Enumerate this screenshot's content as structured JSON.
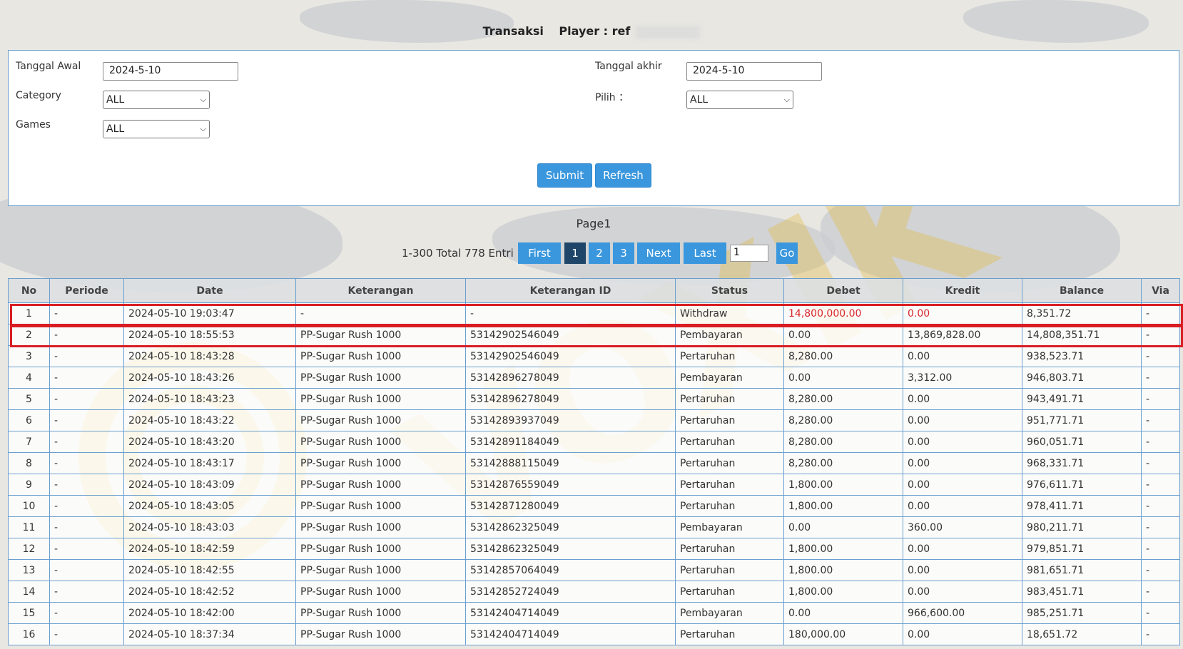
{
  "header": {
    "title": "Transaksi",
    "player_label": "Player : ref"
  },
  "filters": {
    "tanggal_awal_label": "Tanggal Awal",
    "tanggal_awal_value": "2024-5-10",
    "tanggal_akhir_label": "Tanggal akhir",
    "tanggal_akhir_value": "2024-5-10",
    "category_label": "Category",
    "category_value": "ALL",
    "pilih_label": "Pilih ：",
    "pilih_value": "ALL",
    "games_label": "Games",
    "games_value": "ALL",
    "submit_label": "Submit",
    "refresh_label": "Refresh"
  },
  "pagination": {
    "page_title": "Page1",
    "info": "1-300 Total 778 Entri",
    "first": "First",
    "pages": [
      "1",
      "2",
      "3"
    ],
    "next": "Next",
    "last": "Last",
    "goto_value": "1",
    "go": "Go"
  },
  "table": {
    "columns": [
      "No",
      "Periode",
      "Date",
      "Keterangan",
      "Keterangan ID",
      "Status",
      "Debet",
      "Kredit",
      "Balance",
      "Via"
    ],
    "rows": [
      [
        "1",
        "-",
        "2024-05-10 19:03:47",
        "-",
        "-",
        "Withdraw",
        "14,800,000.00",
        "0.00",
        "8,351.72",
        "-"
      ],
      [
        "2",
        "-",
        "2024-05-10 18:55:53",
        "PP-Sugar Rush 1000",
        "53142902546049",
        "Pembayaran",
        "0.00",
        "13,869,828.00",
        "14,808,351.71",
        "-"
      ],
      [
        "3",
        "-",
        "2024-05-10 18:43:28",
        "PP-Sugar Rush 1000",
        "53142902546049",
        "Pertaruhan",
        "8,280.00",
        "0.00",
        "938,523.71",
        "-"
      ],
      [
        "4",
        "-",
        "2024-05-10 18:43:26",
        "PP-Sugar Rush 1000",
        "53142896278049",
        "Pembayaran",
        "0.00",
        "3,312.00",
        "946,803.71",
        "-"
      ],
      [
        "5",
        "-",
        "2024-05-10 18:43:23",
        "PP-Sugar Rush 1000",
        "53142896278049",
        "Pertaruhan",
        "8,280.00",
        "0.00",
        "943,491.71",
        "-"
      ],
      [
        "6",
        "-",
        "2024-05-10 18:43:22",
        "PP-Sugar Rush 1000",
        "53142893937049",
        "Pertaruhan",
        "8,280.00",
        "0.00",
        "951,771.71",
        "-"
      ],
      [
        "7",
        "-",
        "2024-05-10 18:43:20",
        "PP-Sugar Rush 1000",
        "53142891184049",
        "Pertaruhan",
        "8,280.00",
        "0.00",
        "960,051.71",
        "-"
      ],
      [
        "8",
        "-",
        "2024-05-10 18:43:17",
        "PP-Sugar Rush 1000",
        "53142888115049",
        "Pertaruhan",
        "8,280.00",
        "0.00",
        "968,331.71",
        "-"
      ],
      [
        "9",
        "-",
        "2024-05-10 18:43:09",
        "PP-Sugar Rush 1000",
        "53142876559049",
        "Pertaruhan",
        "1,800.00",
        "0.00",
        "976,611.71",
        "-"
      ],
      [
        "10",
        "-",
        "2024-05-10 18:43:05",
        "PP-Sugar Rush 1000",
        "53142871280049",
        "Pertaruhan",
        "1,800.00",
        "0.00",
        "978,411.71",
        "-"
      ],
      [
        "11",
        "-",
        "2024-05-10 18:43:03",
        "PP-Sugar Rush 1000",
        "53142862325049",
        "Pembayaran",
        "0.00",
        "360.00",
        "980,211.71",
        "-"
      ],
      [
        "12",
        "-",
        "2024-05-10 18:42:59",
        "PP-Sugar Rush 1000",
        "53142862325049",
        "Pertaruhan",
        "1,800.00",
        "0.00",
        "979,851.71",
        "-"
      ],
      [
        "13",
        "-",
        "2024-05-10 18:42:55",
        "PP-Sugar Rush 1000",
        "53142857064049",
        "Pertaruhan",
        "1,800.00",
        "0.00",
        "981,651.71",
        "-"
      ],
      [
        "14",
        "-",
        "2024-05-10 18:42:52",
        "PP-Sugar Rush 1000",
        "53142852724049",
        "Pertaruhan",
        "1,800.00",
        "0.00",
        "983,451.71",
        "-"
      ],
      [
        "15",
        "-",
        "2024-05-10 18:42:00",
        "PP-Sugar Rush 1000",
        "53142404714049",
        "Pembayaran",
        "0.00",
        "966,600.00",
        "985,251.71",
        "-"
      ],
      [
        "16",
        "-",
        "2024-05-10 18:37:34",
        "PP-Sugar Rush 1000",
        "53142404714049",
        "Pertaruhan",
        "180,000.00",
        "0.00",
        "18,651.72",
        "-"
      ]
    ],
    "red_row_indexes": [
      0
    ]
  },
  "colors": {
    "accent": "#3a97dd",
    "active_page": "#1f4668",
    "border": "#6b9fcf",
    "highlight": "#d81d23"
  }
}
